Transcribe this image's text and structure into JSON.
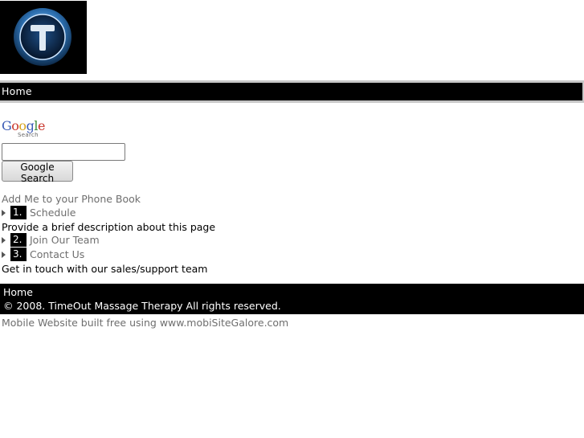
{
  "logo": {
    "letter": "T"
  },
  "nav": {
    "home_label": "Home"
  },
  "search": {
    "logo_text": [
      "G",
      "o",
      "o",
      "g",
      "l",
      "e"
    ],
    "logo_sub": "Search",
    "input_value": "",
    "button_label": "Google Search"
  },
  "links": {
    "phonebook": "Add Me to your Phone Book"
  },
  "menu": [
    {
      "number": "1.",
      "label": "Schedule",
      "description": "Provide a brief description about this page"
    },
    {
      "number": "2.",
      "label": "Join Our Team",
      "description": ""
    },
    {
      "number": "3.",
      "label": "Contact Us",
      "description": "Get in touch with our sales/support team"
    }
  ],
  "footer": {
    "home_label": "Home",
    "copyright": "© 2008. TimeOut Massage Therapy All rights reserved."
  },
  "credit": "Mobile Website built free using www.mobiSiteGalore.com",
  "colors": {
    "nav_bg": "#000000",
    "link_gray": "#6e6e6e",
    "logo_ring": "#2c6fb0"
  }
}
